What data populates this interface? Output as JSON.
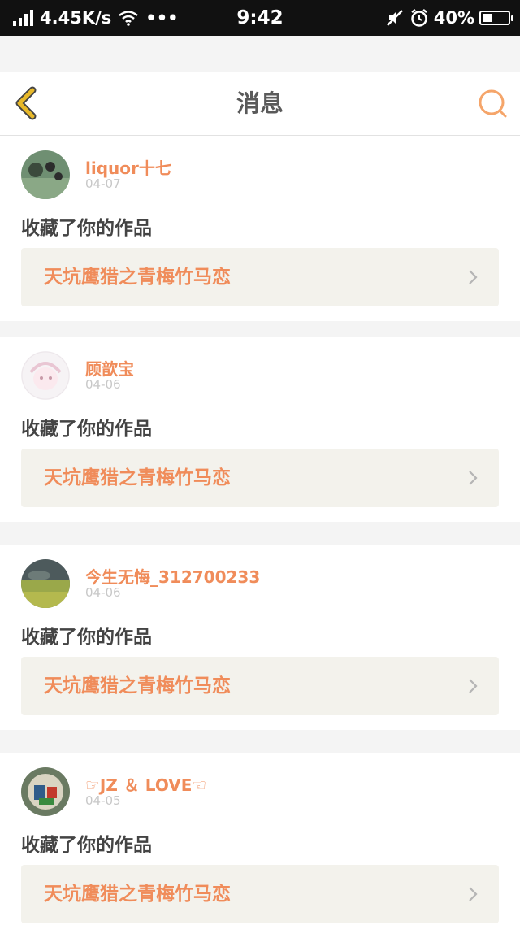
{
  "status_bar": {
    "speed": "4.45K/s",
    "dots": "•••",
    "time": "9:42",
    "battery": "40%",
    "battery_level": 0.4
  },
  "header": {
    "title": "消息"
  },
  "messages": [
    {
      "user": "liquor十七",
      "date": "04-07",
      "action": "收藏了你的作品",
      "work": "天坑鹰猎之青梅竹马恋"
    },
    {
      "user": "顾歆宝",
      "date": "04-06",
      "action": "收藏了你的作品",
      "work": "天坑鹰猎之青梅竹马恋"
    },
    {
      "user": "今生无悔_312700233",
      "date": "04-06",
      "action": "收藏了你的作品",
      "work": "天坑鹰猎之青梅竹马恋"
    },
    {
      "user": "☞JZ ＆ LOVE☜",
      "date": "04-05",
      "action": "收藏了你的作品",
      "work": "天坑鹰猎之青梅竹马恋"
    }
  ],
  "colors": {
    "accent": "#f08c5a",
    "back_icon": "#e8b92a",
    "card_link_bg": "#f3f2ec"
  }
}
